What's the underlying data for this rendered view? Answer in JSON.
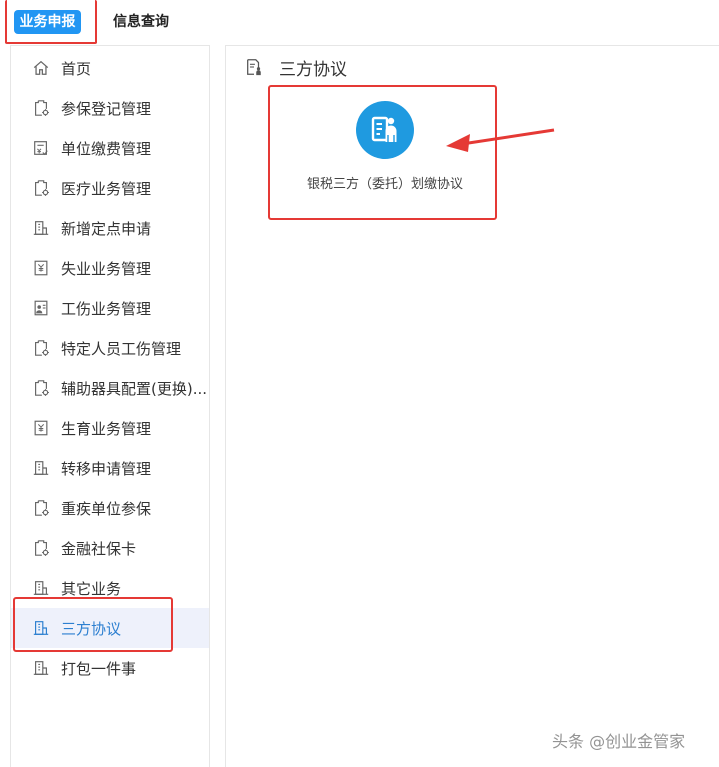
{
  "topnav": {
    "tabs": [
      {
        "label": "业务申报"
      },
      {
        "label": "信息查询"
      }
    ]
  },
  "sidebar": {
    "items": [
      {
        "label": "首页",
        "icon": "home-icon"
      },
      {
        "label": "参保登记管理",
        "icon": "doc-gear-icon"
      },
      {
        "label": "单位缴费管理",
        "icon": "payment-doc-icon"
      },
      {
        "label": "医疗业务管理",
        "icon": "doc-gear-icon"
      },
      {
        "label": "新增定点申请",
        "icon": "building-icon"
      },
      {
        "label": "失业业务管理",
        "icon": "yuan-doc-icon"
      },
      {
        "label": "工伤业务管理",
        "icon": "person-card-icon"
      },
      {
        "label": "特定人员工伤管理",
        "icon": "doc-gear-icon"
      },
      {
        "label": "辅助器具配置(更换)...",
        "icon": "doc-gear-icon"
      },
      {
        "label": "生育业务管理",
        "icon": "yuan-doc-icon"
      },
      {
        "label": "转移申请管理",
        "icon": "building-icon"
      },
      {
        "label": "重疾单位参保",
        "icon": "doc-gear-icon"
      },
      {
        "label": "金融社保卡",
        "icon": "doc-gear-icon"
      },
      {
        "label": "其它业务",
        "icon": "building-icon"
      },
      {
        "label": "三方协议",
        "icon": "building-icon"
      },
      {
        "label": "打包一件事",
        "icon": "building-icon"
      }
    ],
    "active_index": 14
  },
  "content": {
    "title": "三方协议",
    "card": {
      "label": "银税三方（委托）划缴协议",
      "icon": "agreement-icon"
    }
  },
  "colors": {
    "accent": "#2196f3",
    "highlight": "#e53935",
    "active_text": "#2c7fd0",
    "card_icon_bg": "#1f9ae0"
  },
  "watermark": "头条 @创业金管家"
}
